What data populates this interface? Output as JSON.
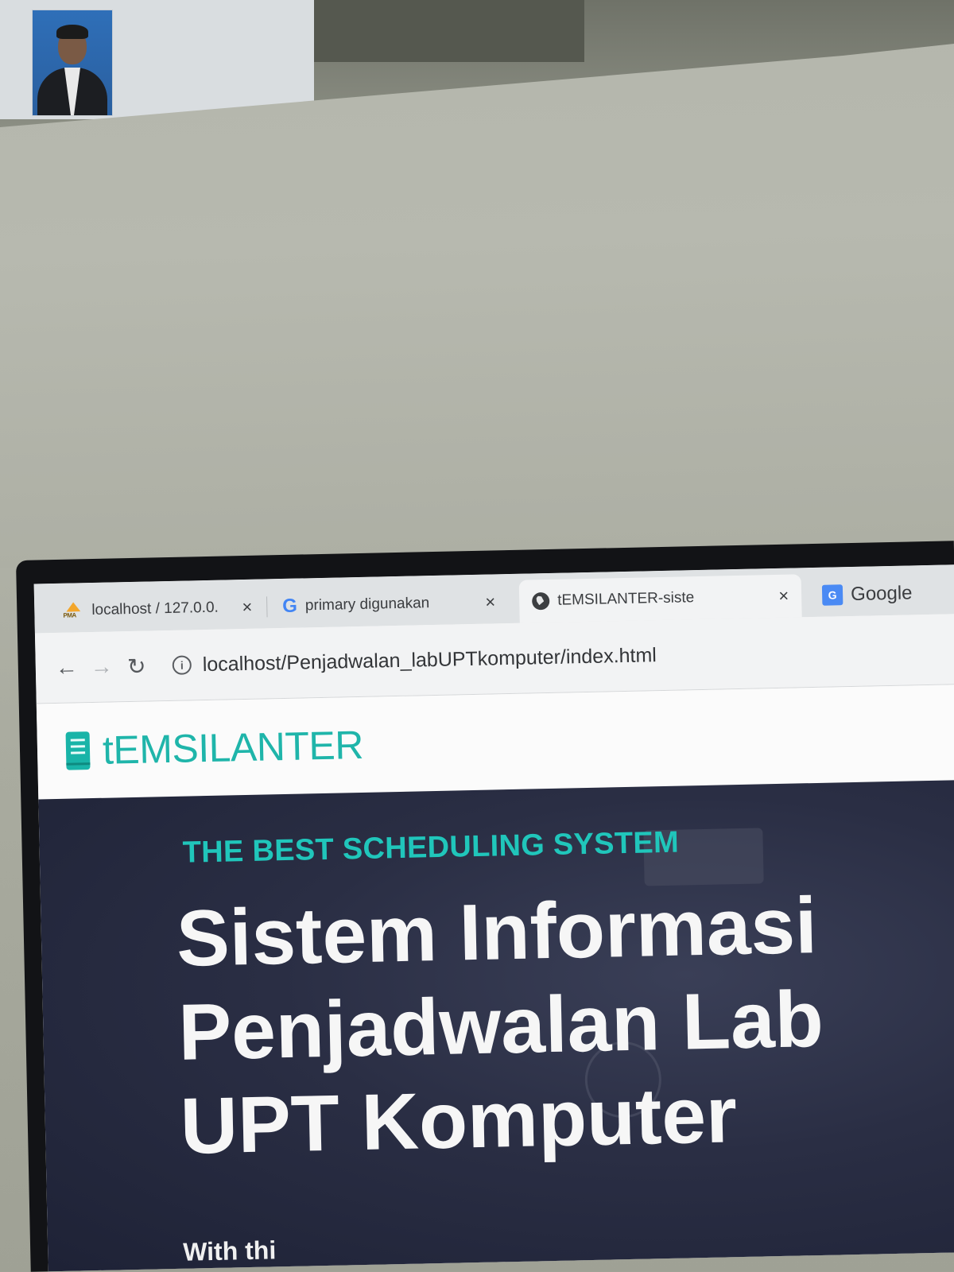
{
  "browser": {
    "tabs": [
      {
        "title": "localhost / 127.0.0.",
        "icon": "phpmyadmin-icon",
        "icon_text": "PMA"
      },
      {
        "title": "primary digunakan",
        "icon": "google-icon",
        "icon_text": "G"
      },
      {
        "title": "tEMSILANTER-siste",
        "icon": "globe-icon"
      },
      {
        "title": "Google",
        "icon": "google-translate-icon",
        "icon_text": "G"
      }
    ],
    "close_glyph": "×",
    "url": "localhost/Penjadwalan_labUPTkomputer/index.html"
  },
  "navbar": {
    "brand": "tEMSILANTER"
  },
  "hero": {
    "eyebrow": "THE BEST SCHEDULING SYSTEM",
    "title": "Sistem Informasi Penjadwalan Lab UPT Komputer",
    "subtitle": "With thi"
  },
  "colors": {
    "accent": "#1fb5aa",
    "hero_bg": "#2a2e44"
  }
}
